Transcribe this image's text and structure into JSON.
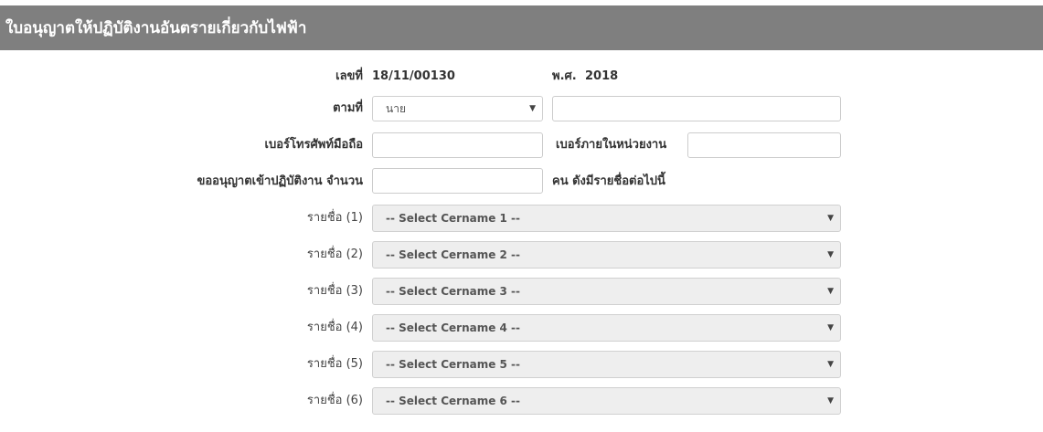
{
  "header": {
    "title": "ใบอนุญาตให้ปฏิบัติงานอันตรายเกี่ยวกับไฟฟ้า"
  },
  "form": {
    "number_label": "เลขที่",
    "number_value": "18/11/00130",
    "year_label": "พ.ศ.",
    "year_value": "2018",
    "per_label": "ตามที่",
    "title_select_value": "นาย",
    "name_input_value": "",
    "mobile_label": "เบอร์โทรศัพท์มือถือ",
    "mobile_value": "",
    "internal_label": "เบอร์ภายในหน่วยงาน",
    "internal_value": "",
    "request_label": "ขออนุญาตเข้าปฏิบัติงาน จำนวน",
    "request_value": "",
    "request_suffix": "คน ดังมีรายชื่อต่อไปนี้"
  },
  "names": [
    {
      "label": "รายชื่อ (1)",
      "placeholder": "-- Select Cername 1 --"
    },
    {
      "label": "รายชื่อ (2)",
      "placeholder": "-- Select Cername 2 --"
    },
    {
      "label": "รายชื่อ (3)",
      "placeholder": "-- Select Cername 3 --"
    },
    {
      "label": "รายชื่อ (4)",
      "placeholder": "-- Select Cername 4 --"
    },
    {
      "label": "รายชื่อ (5)",
      "placeholder": "-- Select Cername 5 --"
    },
    {
      "label": "รายชื่อ (6)",
      "placeholder": "-- Select Cername 6 --"
    }
  ],
  "icons": {
    "dropdown": "triangle-down-icon"
  },
  "colors": {
    "header_bg": "#7f7f7f",
    "select_bg": "#eeeeee",
    "border": "#cccccc"
  }
}
